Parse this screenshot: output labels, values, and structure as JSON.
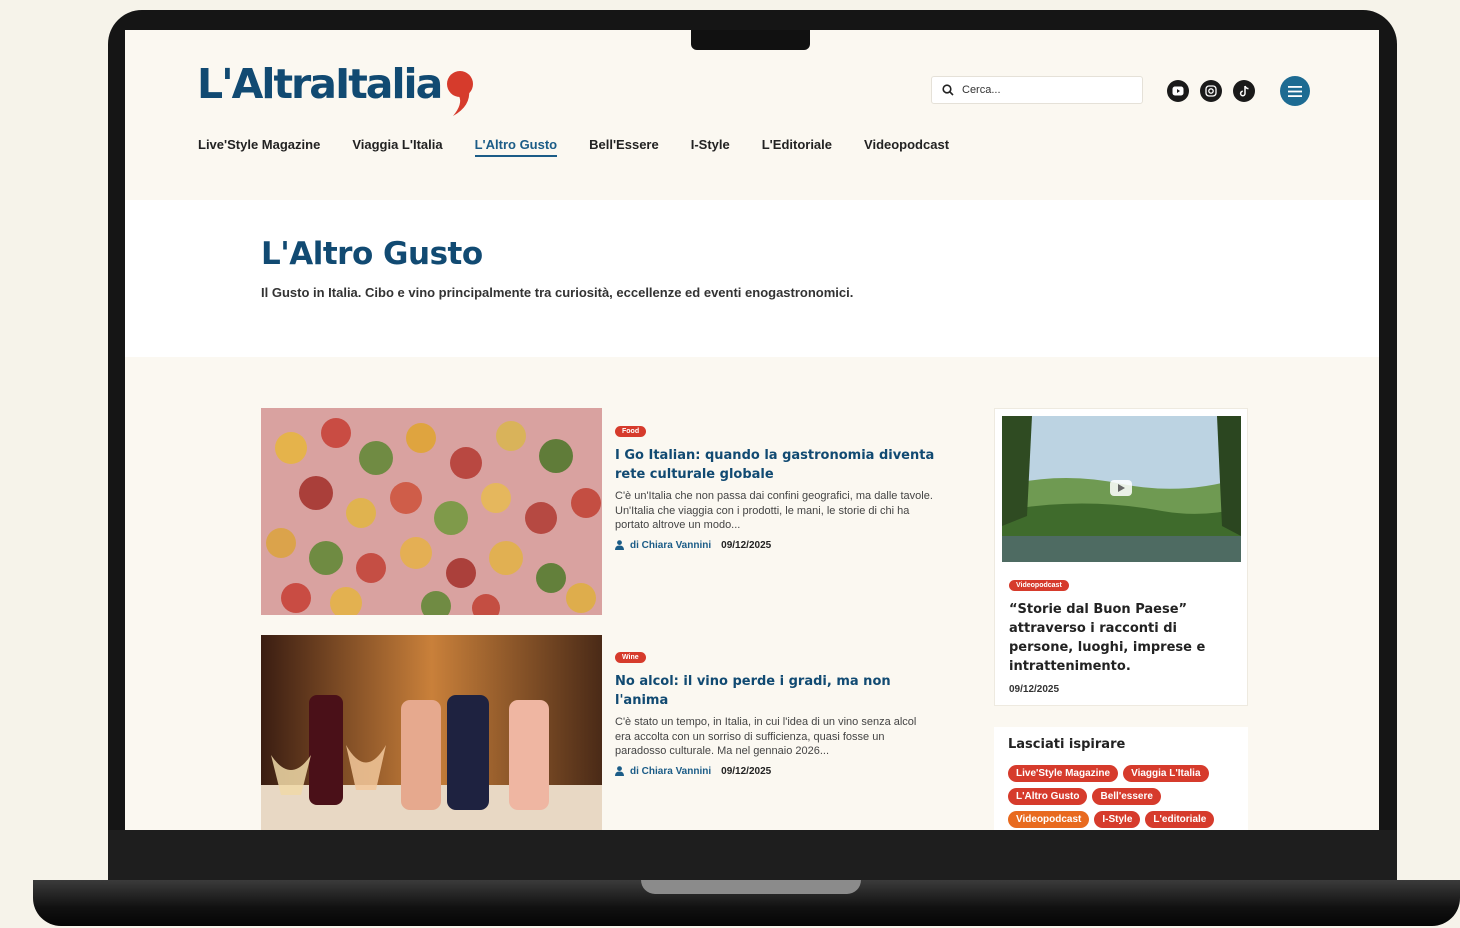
{
  "brand": {
    "logo_text": "L'AltraItalia",
    "primary_color": "#114a72",
    "accent_color": "#d63b2c"
  },
  "header": {
    "search_placeholder": "Cerca...",
    "social_icons": [
      "youtube-icon",
      "instagram-icon",
      "tiktok-icon"
    ],
    "menu_icon": "hamburger-menu-icon"
  },
  "nav": {
    "items": [
      {
        "label": "Live'Style Magazine",
        "active": false
      },
      {
        "label": "Viaggia L'Italia",
        "active": false
      },
      {
        "label": "L'Altro Gusto",
        "active": true
      },
      {
        "label": "Bell'Essere",
        "active": false
      },
      {
        "label": "I-Style",
        "active": false
      },
      {
        "label": "L'Editoriale",
        "active": false
      },
      {
        "label": "Videopodcast",
        "active": false
      }
    ]
  },
  "hero": {
    "title": "L'Altro Gusto",
    "subtitle": "Il Gusto in Italia. Cibo e vino principalmente tra curiosità, eccellenze ed eventi enogastronomici."
  },
  "articles": [
    {
      "category": "Food",
      "title": "I Go Italian: quando la gastronomia diventa rete culturale globale",
      "excerpt": "C'è un'Italia che non passa dai confini geografici, ma dalle tavole. Un'Italia che viaggia con i prodotti, le mani, le storie di chi ha portato altrove un modo...",
      "author": "di Chiara Vannini",
      "date": "09/12/2025"
    },
    {
      "category": "Wine",
      "title": "No alcol: il vino perde i gradi, ma non l'anima",
      "excerpt": "C'è stato un tempo, in Italia, in cui l'idea di un vino senza alcol era accolta con un sorriso di sufficienza, quasi fosse un paradosso culturale. Ma nel gennaio 2026...",
      "author": "di Chiara Vannini",
      "date": "09/12/2025"
    }
  ],
  "video_card": {
    "category": "Videopodcast",
    "title": "“Storie dal Buon Paese” attraverso i racconti di persone, luoghi, imprese e intrattenimento.",
    "date": "09/12/2025"
  },
  "inspire": {
    "title": "Lasciati ispirare",
    "tags": [
      {
        "label": "Live'Style Magazine",
        "color": "#d63b2c"
      },
      {
        "label": "Viaggia L'Italia",
        "color": "#d63b2c"
      },
      {
        "label": "L'Altro Gusto",
        "color": "#d63b2c"
      },
      {
        "label": "Bell'essere",
        "color": "#d63b2c"
      },
      {
        "label": "Videopodcast",
        "color": "#e86a1f"
      },
      {
        "label": "I-Style",
        "color": "#d63b2c"
      },
      {
        "label": "L'editoriale",
        "color": "#d63b2c"
      }
    ]
  }
}
